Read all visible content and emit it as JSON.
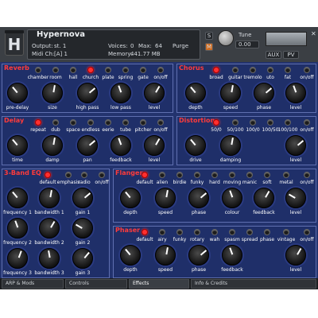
{
  "header": {
    "instrument": "Hypernova",
    "output_label": "Output:",
    "output_value": "st. 1",
    "midi_label": "Midi Ch:",
    "midi_value": "[A] 1",
    "voices_label": "Voices:",
    "voices_value": "0",
    "max_label": "Max:",
    "max_value": "64",
    "purge": "Purge",
    "memory_label": "Memory:",
    "memory_value": "441.77 MB",
    "tune_label": "Tune",
    "tune_value": "0.00",
    "s": "S",
    "m": "M",
    "aux": "AUX",
    "pv": "PV"
  },
  "reverb": {
    "title": "Reverb",
    "buttons": [
      "chamber",
      "room",
      "hall",
      "church",
      "plate",
      "spring",
      "gate",
      "on/off"
    ],
    "knobs": [
      "pre-delay",
      "size",
      "high pass",
      "low pass",
      "level"
    ]
  },
  "chorus": {
    "title": "Chorus",
    "buttons": [
      "broad",
      "guitar",
      "tremolo",
      "uto",
      "fat",
      "on/off"
    ],
    "knobs": [
      "depth",
      "speed",
      "phase",
      "level"
    ]
  },
  "delay": {
    "title": "Delay",
    "buttons": [
      "repeat",
      "dub",
      "space",
      "endless",
      "eerie",
      "tube",
      "pitcher",
      "on/off"
    ],
    "knobs": [
      "time",
      "damp",
      "pan",
      "feedback",
      "level"
    ]
  },
  "distortion": {
    "title": "Distortion",
    "buttons": [
      "50/0",
      "50/100",
      "100/0",
      "100/50",
      "100/100",
      "on/off"
    ],
    "knobs": [
      "drive",
      "damping",
      "level"
    ]
  },
  "eq": {
    "title": "3-Band EQ",
    "buttons": [
      "default",
      "emphasis",
      "radio",
      "on/off"
    ],
    "knobs": [
      "frequency 1",
      "bandwidth 1",
      "gain 1",
      "frequency 2",
      "bandwidth 2",
      "gain 2",
      "frequency 3",
      "bandwidth 3",
      "gain 3"
    ]
  },
  "flanger": {
    "title": "Flanger",
    "buttons": [
      "default",
      "alien",
      "birdie",
      "funky",
      "hard",
      "moving",
      "manic",
      "soft",
      "metal",
      "on/off"
    ],
    "knobs": [
      "depth",
      "speed",
      "phase",
      "colour",
      "feedback",
      "level"
    ]
  },
  "phaser": {
    "title": "Phaser",
    "buttons": [
      "default",
      "airy",
      "funky",
      "rotary",
      "wah",
      "spasm",
      "spread",
      "phase",
      "vintage",
      "on/off"
    ],
    "knobs": [
      "depth",
      "speed",
      "phase",
      "feedback",
      "level"
    ]
  },
  "tabs": [
    "ARP & Mods",
    "Controls",
    "Effects",
    "Info & Credits"
  ]
}
